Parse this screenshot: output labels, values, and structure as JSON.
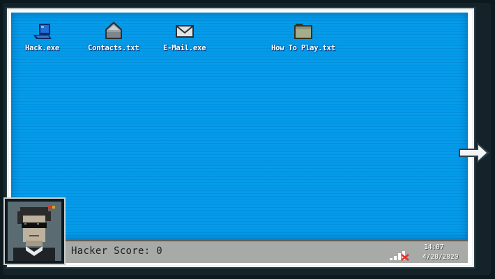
{
  "desktop": {
    "icons": [
      {
        "label": "Hack.exe",
        "icon": "computer-icon"
      },
      {
        "label": "Contacts.txt",
        "icon": "contacts-icon"
      },
      {
        "label": "E-Mail.exe",
        "icon": "envelope-icon"
      },
      {
        "label": "How To Play.txt",
        "icon": "folder-icon"
      }
    ]
  },
  "taskbar": {
    "score_label": "Hacker Score: 0",
    "time": "14:07",
    "date": "4/20/2020",
    "signal_icon": "signal-bars-no-connection-icon"
  },
  "player": {
    "avatar_icon": "hacker-avatar-icon"
  },
  "navigation": {
    "arrow_icon": "right-arrow-icon"
  },
  "colors": {
    "screen": "#049bea",
    "taskbar": "#a8aaa8",
    "error": "#e8302a"
  }
}
